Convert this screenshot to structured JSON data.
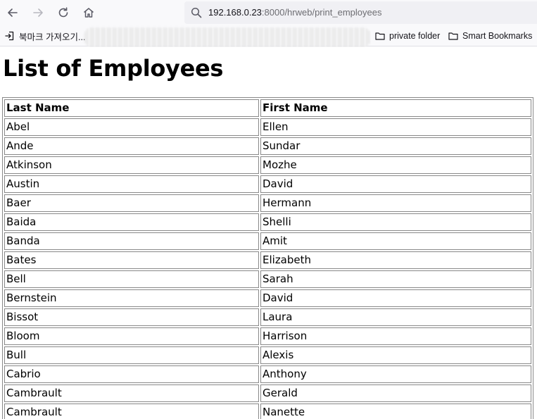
{
  "browser": {
    "url_host": "192.168.0.23",
    "url_rest": ":8000/hrweb/print_employees"
  },
  "bookmarks": {
    "import_label": "북마크 가져오기...",
    "folders": [
      {
        "label": "private folder",
        "icon": "folder-icon"
      },
      {
        "label": "Smart Bookmarks",
        "icon": "folder-icon"
      }
    ]
  },
  "page": {
    "title": "List of Employees",
    "columns": [
      "Last Name",
      "First Name"
    ],
    "rows": [
      [
        "Abel",
        "Ellen"
      ],
      [
        "Ande",
        "Sundar"
      ],
      [
        "Atkinson",
        "Mozhe"
      ],
      [
        "Austin",
        "David"
      ],
      [
        "Baer",
        "Hermann"
      ],
      [
        "Baida",
        "Shelli"
      ],
      [
        "Banda",
        "Amit"
      ],
      [
        "Bates",
        "Elizabeth"
      ],
      [
        "Bell",
        "Sarah"
      ],
      [
        "Bernstein",
        "David"
      ],
      [
        "Bissot",
        "Laura"
      ],
      [
        "Bloom",
        "Harrison"
      ],
      [
        "Bull",
        "Alexis"
      ],
      [
        "Cabrio",
        "Anthony"
      ],
      [
        "Cambrault",
        "Gerald"
      ],
      [
        "Cambrault",
        "Nanette"
      ]
    ]
  }
}
